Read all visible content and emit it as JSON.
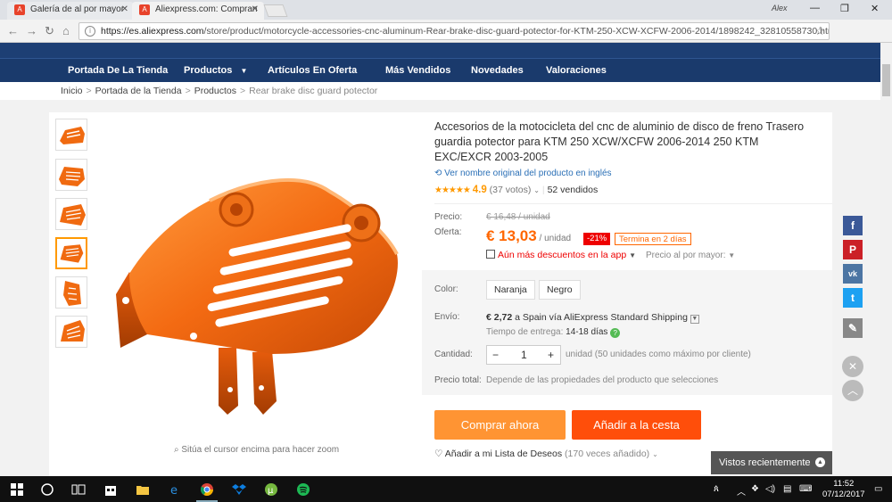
{
  "browser": {
    "tabs": [
      {
        "title": "Galería de al por mayor"
      },
      {
        "title": "Aliexpress.com: Compran"
      }
    ],
    "profile": "Alex",
    "url_host": "https://es.aliexpress.com",
    "url_path": "/store/product/motorcycle-accessories-cnc-aluminum-Rear-brake-disc-guard-potector-for-KTM-250-XCW-XCFW-2006-2014/1898242_32810558730.html?...",
    "extension_badge": "27"
  },
  "store_nav": {
    "items": [
      "Portada De La Tienda",
      "Productos",
      "Artículos En Oferta",
      "Más Vendidos",
      "Novedades",
      "Valoraciones"
    ]
  },
  "breadcrumb": [
    "Inicio",
    "Portada de la Tienda",
    "Productos",
    "Rear brake disc guard potector"
  ],
  "gallery": {
    "zoom_hint": "Sitúa el cursor encima para hacer zoom",
    "thumb_count": 6,
    "selected_thumb": 4
  },
  "product": {
    "title": "Accesorios de la motocicleta del cnc de aluminio de disco de freno Trasero guardia potector para KTM 250 XCW/XCFW 2006-2014 250 KTM EXC/EXCR 2003-2005",
    "translate_link": "Ver nombre original del producto en inglés",
    "stars": "★★★★★",
    "rating": "4.9",
    "votes": "(37 votos)",
    "sold": "52 vendidos",
    "price_label": "Precio:",
    "old_price": "€ 16,48 / unidad",
    "offer_label": "Oferta:",
    "new_price": "€ 13,03",
    "unit": " / unidad",
    "discount": "-21%",
    "ends": "Termina en 2 días",
    "app_discount": "Aún más descuentos en la app",
    "wholesale": "Precio al por mayor:",
    "color_label": "Color:",
    "colors": [
      "Naranja",
      "Negro"
    ],
    "shipping_label": "Envío:",
    "shipping_price": "€ 2,72",
    "shipping_text": " a Spain vía AliExpress Standard Shipping",
    "delivery_label": "Tiempo de entrega:",
    "delivery_days": "14-18 días",
    "quantity_label": "Cantidad:",
    "quantity": "1",
    "quantity_note": "unidad (50 unidades como máximo por cliente)",
    "total_label": "Precio total:",
    "total_note": "Depende de las propiedades del producto que selecciones",
    "buy_now": "Comprar ahora",
    "add_to_cart": "Añadir a la cesta",
    "wishlist": "Añadir a mi Lista de Deseos",
    "wishlist_count": "(170 veces añadido)"
  },
  "recently_viewed": "Vistos recientemente",
  "taskbar": {
    "time": "11:52",
    "date": "07/12/2017"
  },
  "colors": {
    "accent_orange": "#ff4e0a",
    "buy_orange": "#ff9433",
    "store_nav_blue": "#1a3a6c",
    "price_orange": "#ff6600"
  }
}
